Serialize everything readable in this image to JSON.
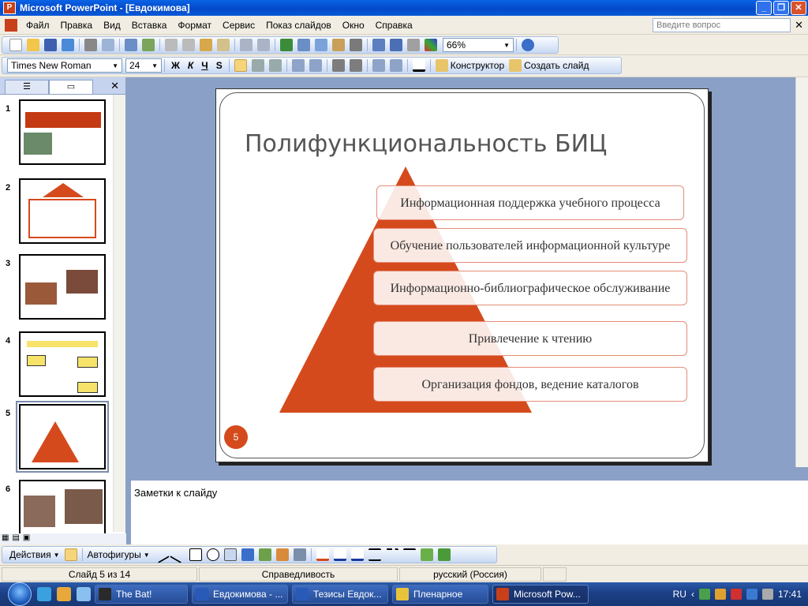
{
  "window": {
    "title": "Microsoft PowerPoint - [Евдокимова]",
    "app_icon": "P"
  },
  "menu": {
    "items": [
      "Файл",
      "Правка",
      "Вид",
      "Вставка",
      "Формат",
      "Сервис",
      "Показ слайдов",
      "Окно",
      "Справка"
    ],
    "ask_placeholder": "Введите вопрос"
  },
  "standard_toolbar": {
    "zoom": "66%"
  },
  "format_toolbar": {
    "font": "Times New Roman",
    "size": "24",
    "bold": "Ж",
    "italic": "К",
    "underline": "Ч",
    "shadow": "S",
    "designer": "Конструктор",
    "new_slide": "Создать слайд"
  },
  "thumbnails": [
    {
      "num": "1"
    },
    {
      "num": "2"
    },
    {
      "num": "3"
    },
    {
      "num": "4"
    },
    {
      "num": "5"
    },
    {
      "num": "6"
    }
  ],
  "slide": {
    "title": "Полифункциональность БИЦ",
    "items": [
      "Информационная поддержка учебного процесса",
      "Обучение пользователей информационной культуре",
      "Информационно-библиографическое обслуживание",
      "Привлечение к чтению",
      "Организация фондов, ведение каталогов"
    ],
    "number": "5",
    "accent": "#d54a1c"
  },
  "notes": {
    "placeholder": "Заметки к слайду"
  },
  "drawing_toolbar": {
    "actions": "Действия",
    "autoshapes": "Автофигуры"
  },
  "status": {
    "slide": "Слайд 5 из 14",
    "design": "Справедливость",
    "language": "русский (Россия)"
  },
  "taskbar": {
    "buttons": [
      "The Bat!",
      "Евдокимова - ...",
      "Тезисы Евдок...",
      "Пленарное",
      "Microsoft Pow..."
    ],
    "lang": "RU",
    "time": "17:41"
  }
}
